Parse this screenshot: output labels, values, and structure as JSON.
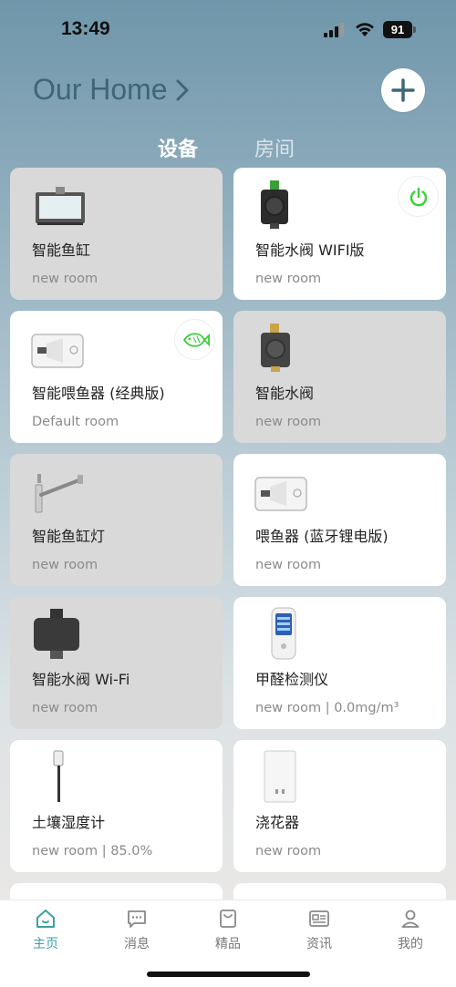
{
  "status": {
    "time": "13:49",
    "battery": "91"
  },
  "header": {
    "title": "Our Home"
  },
  "tabs": [
    "设备",
    "房间"
  ],
  "devices": [
    {
      "name": "智能鱼缸",
      "sub": "new room"
    },
    {
      "name": "智能水阀 WIFI版",
      "sub": "new room"
    },
    {
      "name": "智能喂鱼器 (经典版)",
      "sub": "Default room"
    },
    {
      "name": "智能水阀",
      "sub": "new room"
    },
    {
      "name": "智能鱼缸灯",
      "sub": "new room"
    },
    {
      "name": "喂鱼器 (蓝牙锂电版)",
      "sub": "new room"
    },
    {
      "name": "智能水阀 Wi-Fi",
      "sub": "new room"
    },
    {
      "name": "甲醛检测仪",
      "sub": "new room | 0.0mg/m³"
    },
    {
      "name": "土壤湿度计",
      "sub": "new room | 85.0%"
    },
    {
      "name": "浇花器",
      "sub": "new room"
    }
  ],
  "tabbar": [
    "主页",
    "消息",
    "精品",
    "资讯",
    "我的"
  ],
  "colors": {
    "accent": "#3aa0a8",
    "title": "#3f6677",
    "power": "#3ccf3c"
  }
}
